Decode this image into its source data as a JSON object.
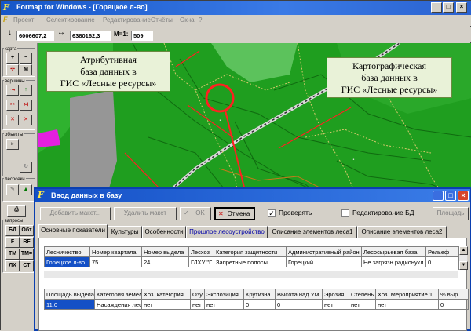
{
  "window": {
    "title": "Formap for Windows - [Горецкое л-во]",
    "min": "_",
    "max": "□",
    "close": "×"
  },
  "menu": {
    "icon": "F",
    "items": [
      "Проект",
      "Селектирование",
      "Редактирование",
      "Отчёты",
      "Окна",
      "?"
    ]
  },
  "coords": {
    "x_value": "6006607,2",
    "y_value": "6380162,3",
    "scale_label": "M=1:",
    "scale_value": "509"
  },
  "left_panel": {
    "groups": [
      "карта",
      "вершины",
      "объекты",
      "лесосеки",
      "запросы"
    ],
    "query_buttons": [
      "БД",
      "Обт",
      "F",
      "RF",
      "ТМ",
      "ТМ=",
      "ЛХ",
      "СТ"
    ]
  },
  "callouts": {
    "attr": [
      "Атрибутивная",
      "база данных в",
      "ГИС «Лесные ресурсы»"
    ],
    "carto": [
      "Картографическая",
      "база данных в",
      "ГИС «Лесные ресурсы»"
    ]
  },
  "dialog": {
    "title": "Ввод данных в базу",
    "buttons": {
      "add": "Добавить макет...",
      "delete": "Удалить макет",
      "ok": "OK",
      "cancel": "Отмена",
      "area": "Площадь"
    },
    "check_verify": {
      "label": "Проверять",
      "checked": true
    },
    "check_edit": {
      "label": "Редактирование БД",
      "checked": false
    },
    "tabs": [
      "Основные показатели",
      "Культуры",
      "Особенности",
      "Прошлое лесоустройство",
      "Описание элементов леса1",
      "Описание элементов леса2"
    ],
    "table1": {
      "headers": [
        "Лесничество",
        "Номер квартала",
        "Номер выдела",
        "Лесхоз",
        "Категория защитности",
        "Административный район",
        "Лесосырьевая база",
        "Рельеф"
      ],
      "row": [
        "Горецкое л-во",
        "75",
        "24",
        "ГЛХУ \"Г",
        "Запретные полосы",
        "Горецкий",
        "Не загрязн.радионукл.",
        "0"
      ]
    },
    "table2": {
      "headers": [
        "Площадь выдела",
        "Категория земель",
        "Хоз. категория",
        "Озу",
        "Экспозиция",
        "Крутизна",
        "Высота над УМ",
        "Эрозия",
        "Степень",
        "Хоз. Мероприятие 1",
        "% выр"
      ],
      "row": [
        "11,0",
        "Насаждения лесные",
        "нет",
        "нет",
        "нет",
        "0",
        "0",
        "нет",
        "нет",
        "нет",
        "0"
      ]
    }
  },
  "colors": {
    "map_green": "#1f9e1f",
    "title_blue": "#1656c8",
    "callout_bg": "#e9f2d8",
    "highlight": "#ff2020"
  }
}
